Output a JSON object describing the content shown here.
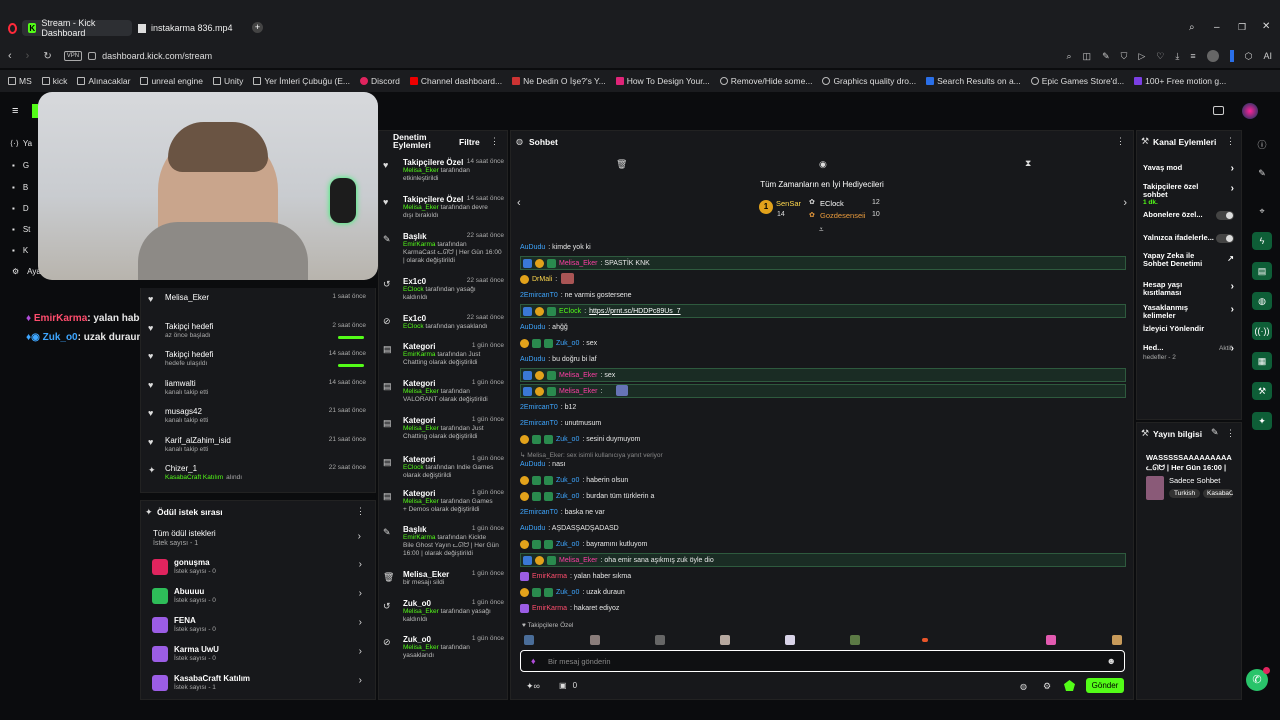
{
  "browser": {
    "tabs": [
      {
        "label": "Stream - Kick Dashboard",
        "active": true
      },
      {
        "label": "instakarma 836.mp4",
        "active": false
      }
    ],
    "url": "dashboard.kick.com/stream",
    "vpn": "VPN",
    "ai_label": "AI",
    "bookmarks": [
      "MS",
      "kick",
      "Alınacaklar",
      "unreal engine",
      "Unity",
      "Yer İmleri Çubuğu (E...",
      "Discord",
      "Channel dashboard...",
      "Ne Dedin O İşe?'s Y...",
      "How To Design Your...",
      "Remove/Hide some...",
      "Graphics quality dro...",
      "Search Results on a...",
      "Epic Games Store'd...",
      "100+ Free motion g..."
    ]
  },
  "sidebar_partial": [
    "Ya",
    "G",
    "B",
    "D",
    "St",
    "K",
    "Aya"
  ],
  "overlay_chat": [
    {
      "user": "EmirKarma",
      "text": ": yalan haber sıkma"
    },
    {
      "user": "Zuk_o0",
      "text": ": uzak duraun"
    }
  ],
  "activity": [
    {
      "name": "Melisa_Eker",
      "sub": "",
      "time": "1 saat önce",
      "icon": "heart-icon"
    },
    {
      "name": "Takipçi hedefi",
      "sub": "az önce başladı",
      "time": "2 saat önce",
      "icon": "heart-icon",
      "progress": 1.0
    },
    {
      "name": "Takipçi hedefi",
      "sub": "hedefe ulaşıldı",
      "time": "14 saat önce",
      "icon": "heart-icon",
      "progress": 1.0
    },
    {
      "name": "liamwalti",
      "sub": "kanalı takip etti",
      "time": "14 saat önce",
      "icon": "heart-icon"
    },
    {
      "name": "musags42",
      "sub": "kanalı takip etti",
      "time": "21 saat önce",
      "icon": "heart-icon"
    },
    {
      "name": "Karif_alZahim_isid",
      "sub": "kanalı takip etti",
      "time": "21 saat önce",
      "icon": "heart-icon"
    },
    {
      "name": "Chizer_1",
      "sub": "KasabaCraft Katılım",
      "sub2": "alındı",
      "time": "22 saat önce",
      "icon": "gift-icon"
    }
  ],
  "rewards": {
    "title": "Ödül istek sırası",
    "all_label": "Tüm ödül istekleri",
    "all_count": "İstek sayısı - 1",
    "items": [
      {
        "name": "gonuşma",
        "count": "İstek sayısı - 0",
        "color": "#e0245e"
      },
      {
        "name": "Abuuuu",
        "count": "İstek sayısı - 0",
        "color": "#2ebd59"
      },
      {
        "name": "FENA",
        "count": "İstek sayısı - 0",
        "color": "#9b5de5"
      },
      {
        "name": "Karma UwU",
        "count": "İstek sayısı - 0",
        "color": "#9b5de5"
      },
      {
        "name": "KasabaCraft Katılım",
        "count": "İstek sayısı - 1",
        "color": "#9b5de5"
      }
    ]
  },
  "mod": {
    "title": "Denetim Eylemleri",
    "filter": "Filtre",
    "items": [
      {
        "t": "Takipçilere Özel",
        "time": "14 saat önce",
        "l1": "Melisa_Eker",
        "l2": " tarafından",
        "l3": "etkinleştirildi",
        "icon": "heart-icon"
      },
      {
        "t": "Takipçilere Özel",
        "time": "14 saat önce",
        "l1": "Melisa_Eker",
        "l2": " tarafından devre",
        "l3": "dışı bırakıldı",
        "icon": "heart-icon"
      },
      {
        "t": "Başlık",
        "time": "22 saat önce",
        "l1": "EmirKarma",
        "l2": " tarafından",
        "l3": "KarmaCast ᓚᘏᗢ | Her Gün 16:00 | olarak değiştirildi",
        "icon": "pencil-icon"
      },
      {
        "t": "Ex1c0",
        "time": "22 saat önce",
        "l1": "EClock",
        "l2": " tarafından yasağı",
        "l3": "kaldırıldı",
        "icon": "undo-icon"
      },
      {
        "t": "Ex1c0",
        "time": "22 saat önce",
        "l1": "EClock",
        "l2": " tarafından yasaklandı",
        "l3": "",
        "icon": "ban-icon"
      },
      {
        "t": "Kategori",
        "time": "1 gün önce",
        "l1": "EmirKarma",
        "l2": " tarafından Just",
        "l3": "Chatting olarak değiştirildi",
        "icon": "category-icon"
      },
      {
        "t": "Kategori",
        "time": "1 gün önce",
        "l1": "Melisa_Eker",
        "l2": " tarafından",
        "l3": "VALORANT olarak değiştirildi",
        "icon": "category-icon"
      },
      {
        "t": "Kategori",
        "time": "1 gün önce",
        "l1": "Melisa_Eker",
        "l2": " tarafından Just",
        "l3": "Chatting olarak değiştirildi",
        "icon": "category-icon"
      },
      {
        "t": "Kategori",
        "time": "1 gün önce",
        "l1": "EClock",
        "l2": " tarafından Indie Games",
        "l3": "olarak değiştirildi",
        "icon": "category-icon"
      },
      {
        "t": "Kategori",
        "time": "1 gün önce",
        "l1": "Melisa_Eker",
        "l2": " tarafından Games",
        "l3": "+ Demos olarak değiştirildi",
        "icon": "category-icon"
      },
      {
        "t": "Başlık",
        "time": "1 gün önce",
        "l1": "EmirKarma",
        "l2": " tarafından Kickte",
        "l3": "Bile Ghost Yayın ᓚᘏᗢ | Her Gün 16:00 | olarak değiştirildi",
        "icon": "pencil-icon"
      },
      {
        "t": "Melisa_Eker",
        "time": "1 gün önce",
        "l1": "",
        "l2": "bir mesajı sildi",
        "l3": "",
        "icon": "trash-icon"
      },
      {
        "t": "Zuk_o0",
        "time": "1 gün önce",
        "l1": "Melisa_Eker",
        "l2": " tarafından yasağı",
        "l3": "kaldırıldı",
        "icon": "undo-icon"
      },
      {
        "t": "Zuk_o0",
        "time": "1 gün önce",
        "l1": "Melisa_Eker",
        "l2": " tarafından",
        "l3": "yasaklandı",
        "icon": "ban-icon"
      }
    ]
  },
  "chat": {
    "title": "Sohbet",
    "gifters_title": "Tüm Zamanların en İyi Hediyecileri",
    "gifters": [
      {
        "rank": "1",
        "name": "SenSar",
        "count": "14"
      },
      {
        "name": "EClock",
        "count": "12"
      },
      {
        "name": "Gozdesenseii",
        "count": "10"
      }
    ],
    "messages": [
      {
        "user": "AuDudu",
        "text": ": kimde yok ki",
        "color": "u-blue",
        "hl": false,
        "badges": []
      },
      {
        "user": "Melisa_Eker",
        "text": ": SPASTİK KNK",
        "color": "u-pink",
        "hl": true,
        "badges": [
          "b-blue",
          "b-gold",
          "b-green"
        ]
      },
      {
        "user": "DrMali",
        "text": ":",
        "color": "u-yel",
        "hl": false,
        "badges": [
          "b-gold"
        ]
      },
      {
        "user": "2EmircanT0",
        "text": ": ne varmis gostersene",
        "color": "u-blue",
        "hl": false,
        "badges": []
      },
      {
        "user": "EClock",
        "text": ": ",
        "link": "https://prnt.sc/HDDPc89Us_7",
        "color": "u-green",
        "hl": true,
        "badges": [
          "b-blue",
          "b-gold",
          "b-green"
        ]
      },
      {
        "user": "AuDudu",
        "text": ": ahğğ",
        "color": "u-blue",
        "hl": false,
        "badges": []
      },
      {
        "user": "Zuk_o0",
        "text": ": sex",
        "color": "u-blue",
        "hl": false,
        "badges": [
          "b-gold",
          "b-green",
          "b-green"
        ]
      },
      {
        "user": "AuDudu",
        "text": ": bu doğru bi laf",
        "color": "u-blue",
        "hl": false,
        "badges": []
      },
      {
        "user": "Melisa_Eker",
        "text": ": sex",
        "color": "u-pink",
        "hl": true,
        "badges": [
          "b-blue",
          "b-gold",
          "b-green"
        ]
      },
      {
        "user": "Melisa_Eker",
        "text": ":",
        "color": "u-pink",
        "hl": true,
        "badges": [
          "b-blue",
          "b-gold",
          "b-green"
        ]
      },
      {
        "user": "2EmircanT0",
        "text": ": b12",
        "color": "u-blue",
        "hl": false,
        "badges": []
      },
      {
        "user": "2EmircanT0",
        "text": ": unutmusum",
        "color": "u-blue",
        "hl": false,
        "badges": []
      },
      {
        "user": "Zuk_o0",
        "text": ": sesini duymuyom",
        "color": "u-blue",
        "hl": false,
        "badges": [
          "b-gold",
          "b-green",
          "b-green"
        ]
      },
      {
        "user": "",
        "text": "↳ Melisa_Eker: sex isimli kullanıcıya yanıt veriyor",
        "color": "",
        "hl": false,
        "badges": [],
        "reply": true
      },
      {
        "user": "AuDudu",
        "text": ": nası",
        "color": "u-blue",
        "hl": false,
        "badges": []
      },
      {
        "user": "Zuk_o0",
        "text": ": haberin olsun",
        "color": "u-blue",
        "hl": false,
        "badges": [
          "b-gold",
          "b-green",
          "b-green"
        ]
      },
      {
        "user": "Zuk_o0",
        "text": ": burdan tüm türklerin a",
        "color": "u-blue",
        "hl": false,
        "badges": [
          "b-gold",
          "b-green",
          "b-green"
        ]
      },
      {
        "user": "2EmircanT0",
        "text": ": baska ne var",
        "color": "u-blue",
        "hl": false,
        "badges": []
      },
      {
        "user": "AuDudu",
        "text": ": AŞDASŞADŞADASD",
        "color": "u-blue",
        "hl": false,
        "badges": []
      },
      {
        "user": "Zuk_o0",
        "text": ": bayramını kutluyom",
        "color": "u-blue",
        "hl": false,
        "badges": [
          "b-gold",
          "b-green",
          "b-green"
        ]
      },
      {
        "user": "Melisa_Eker",
        "text": ": oha emir sana aşıkmış zuk öyle dio",
        "color": "u-pink",
        "hl": true,
        "badges": [
          "b-blue",
          "b-gold",
          "b-green"
        ]
      },
      {
        "user": "EmirKarma",
        "text": ": yalan haber sıkma",
        "color": "u-red",
        "hl": false,
        "badges": [
          "b-purple"
        ]
      },
      {
        "user": "Zuk_o0",
        "text": ": uzak duraun",
        "color": "u-blue",
        "hl": false,
        "badges": [
          "b-gold",
          "b-green",
          "b-green"
        ]
      },
      {
        "user": "EmirKarma",
        "text": ": hakaret ediyoz",
        "color": "u-red",
        "hl": false,
        "badges": [
          "b-purple"
        ]
      }
    ],
    "followers_only": "Takipçilere Özel",
    "input_placeholder": "Bir mesaj gönderin",
    "count": "0",
    "send": "Gönder"
  },
  "kanal": {
    "title": "Kanal Eylemleri",
    "items": [
      {
        "label": "Yavaş mod",
        "type": "chev"
      },
      {
        "label": "Takipçilere özel sohbet",
        "sub": "1 dk.",
        "type": "chev"
      },
      {
        "label": "Abonelere özel...",
        "type": "toggle"
      },
      {
        "label": "Yalnızca ifadelerle...",
        "type": "toggle"
      },
      {
        "label": "Yapay Zeka ile Sohbet Denetimi",
        "type": "ext"
      },
      {
        "label": "Hesap yaşı kısıtlaması",
        "type": "chev"
      },
      {
        "label": "Yasaklanmış kelimeler",
        "type": "chev"
      },
      {
        "label": "İzleyici Yönlendir",
        "type": "none"
      },
      {
        "label": "Hed...",
        "sub": "Aktif hedefler - 2",
        "type": "chev"
      }
    ]
  },
  "stream_info": {
    "title": "Yayın bilgisi",
    "stream_title": "WASSSSSAAAAAAAAAᓚᘏᗢ | Her Gün 16:00 |",
    "category": "Sadece Sohbet",
    "tags": [
      "Turkish",
      "KasabaC"
    ]
  },
  "colors": {
    "accent": "#53fc18",
    "panel": "#17181b",
    "bg": "#0b0c0e"
  }
}
